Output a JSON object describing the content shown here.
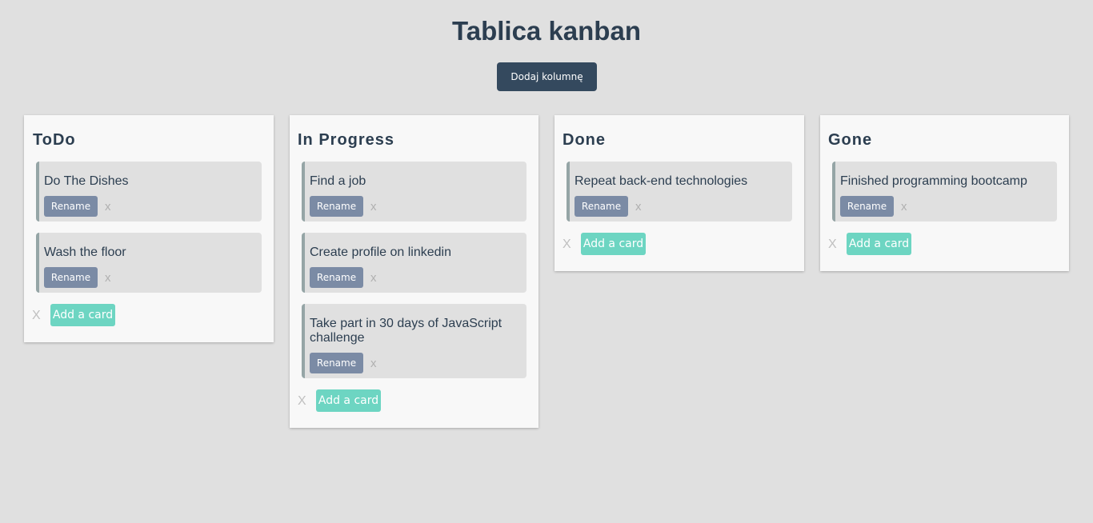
{
  "header": {
    "title": "Tablica kanban",
    "add_column_label": "Dodaj kolumnę"
  },
  "columns": [
    {
      "title": "ToDo",
      "delete_label": "X",
      "add_card_label": "Add a card",
      "cards": [
        {
          "text": "Do The Dishes",
          "rename_label": "Rename",
          "delete_label": "x"
        },
        {
          "text": "Wash the floor",
          "rename_label": "Rename",
          "delete_label": "x"
        }
      ]
    },
    {
      "title": "In Progress",
      "delete_label": "X",
      "add_card_label": "Add a card",
      "cards": [
        {
          "text": "Find a job",
          "rename_label": "Rename",
          "delete_label": "x"
        },
        {
          "text": "Create profile on linkedin",
          "rename_label": "Rename",
          "delete_label": "x"
        },
        {
          "text": "Take part in 30 days of JavaScript challenge",
          "rename_label": "Rename",
          "delete_label": "x"
        }
      ]
    },
    {
      "title": "Done",
      "delete_label": "X",
      "add_card_label": "Add a card",
      "cards": [
        {
          "text": "Repeat back-end technologies",
          "rename_label": "Rename",
          "delete_label": "x"
        }
      ]
    },
    {
      "title": "Gone",
      "delete_label": "X",
      "add_card_label": "Add a card",
      "cards": [
        {
          "text": "Finished programming bootcamp",
          "rename_label": "Rename",
          "delete_label": "x"
        }
      ]
    }
  ]
}
